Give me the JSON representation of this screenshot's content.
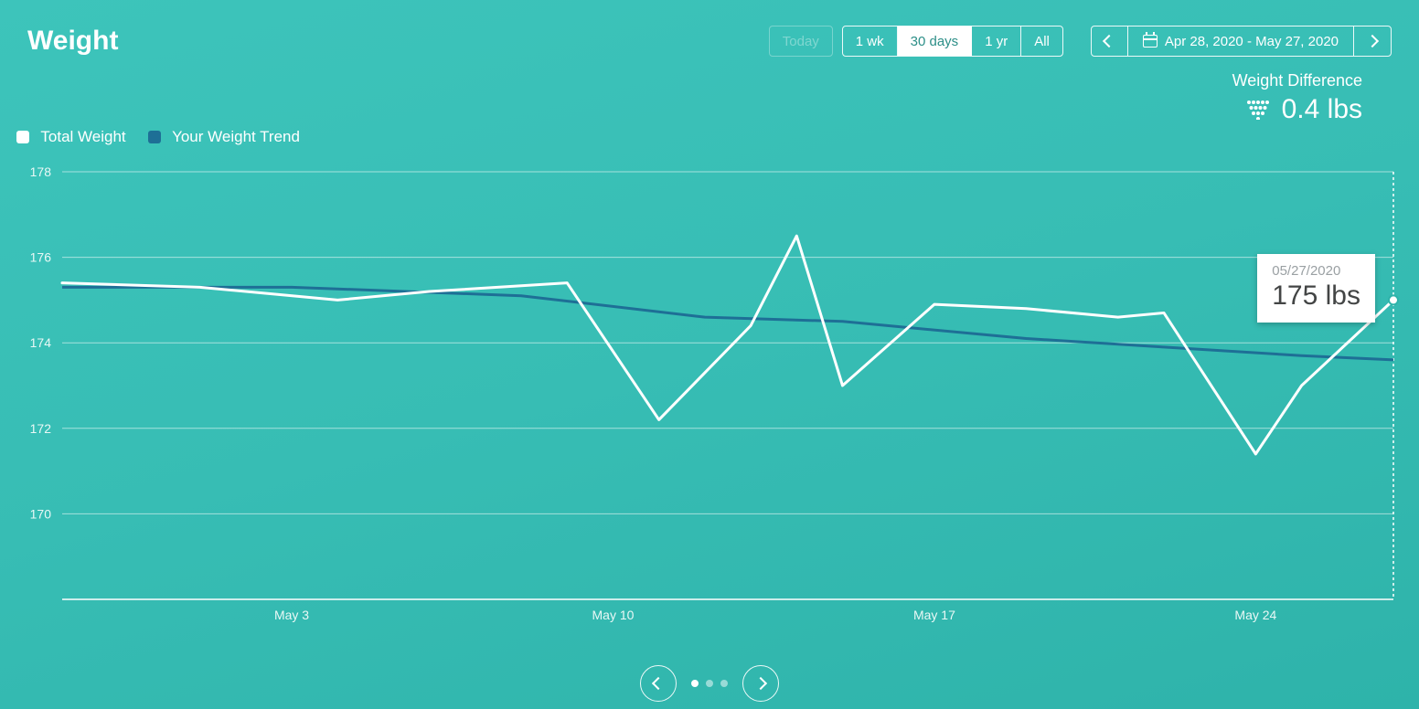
{
  "title": "Weight",
  "range_buttons": {
    "today": "Today",
    "wk": "1 wk",
    "days30": "30 days",
    "yr": "1 yr",
    "all": "All",
    "active": "days30",
    "today_disabled": true
  },
  "date_range": "Apr 28, 2020 - May 27, 2020",
  "diff": {
    "label": "Weight Difference",
    "value": "0.4 lbs"
  },
  "legend": {
    "total": "Total Weight",
    "trend": "Your Weight Trend",
    "total_color": "#ffffff",
    "trend_color": "#1e6f96"
  },
  "tooltip": {
    "date": "05/27/2020",
    "value": "175 lbs"
  },
  "pager": {
    "count": 3,
    "active": 0
  },
  "chart_data": {
    "type": "line",
    "xlabel": "",
    "ylabel": "",
    "ylim": [
      168,
      178
    ],
    "y_ticks": [
      170,
      172,
      174,
      176,
      178
    ],
    "x_tick_labels": [
      "May 3",
      "May 10",
      "May 17",
      "May 24"
    ],
    "x_tick_dates": [
      "2020-05-03",
      "2020-05-10",
      "2020-05-17",
      "2020-05-24"
    ],
    "x_start": "2020-04-28",
    "x_end": "2020-05-27",
    "goal_line_x": "2020-05-27",
    "series": [
      {
        "name": "Total Weight",
        "color": "#ffffff",
        "points": [
          {
            "date": "2020-04-28",
            "y": 175.4
          },
          {
            "date": "2020-05-01",
            "y": 175.3
          },
          {
            "date": "2020-05-04",
            "y": 175.0
          },
          {
            "date": "2020-05-06",
            "y": 175.2
          },
          {
            "date": "2020-05-09",
            "y": 175.4
          },
          {
            "date": "2020-05-11",
            "y": 172.2
          },
          {
            "date": "2020-05-13",
            "y": 174.4
          },
          {
            "date": "2020-05-14",
            "y": 176.5
          },
          {
            "date": "2020-05-15",
            "y": 173.0
          },
          {
            "date": "2020-05-17",
            "y": 174.9
          },
          {
            "date": "2020-05-19",
            "y": 174.8
          },
          {
            "date": "2020-05-21",
            "y": 174.6
          },
          {
            "date": "2020-05-22",
            "y": 174.7
          },
          {
            "date": "2020-05-24",
            "y": 171.4
          },
          {
            "date": "2020-05-25",
            "y": 173.0
          },
          {
            "date": "2020-05-27",
            "y": 175.0
          }
        ]
      },
      {
        "name": "Your Weight Trend",
        "color": "#1e6f96",
        "points": [
          {
            "date": "2020-04-28",
            "y": 175.3
          },
          {
            "date": "2020-05-03",
            "y": 175.3
          },
          {
            "date": "2020-05-08",
            "y": 175.1
          },
          {
            "date": "2020-05-12",
            "y": 174.6
          },
          {
            "date": "2020-05-15",
            "y": 174.5
          },
          {
            "date": "2020-05-19",
            "y": 174.1
          },
          {
            "date": "2020-05-22",
            "y": 173.9
          },
          {
            "date": "2020-05-25",
            "y": 173.7
          },
          {
            "date": "2020-05-27",
            "y": 173.6
          }
        ]
      }
    ]
  }
}
